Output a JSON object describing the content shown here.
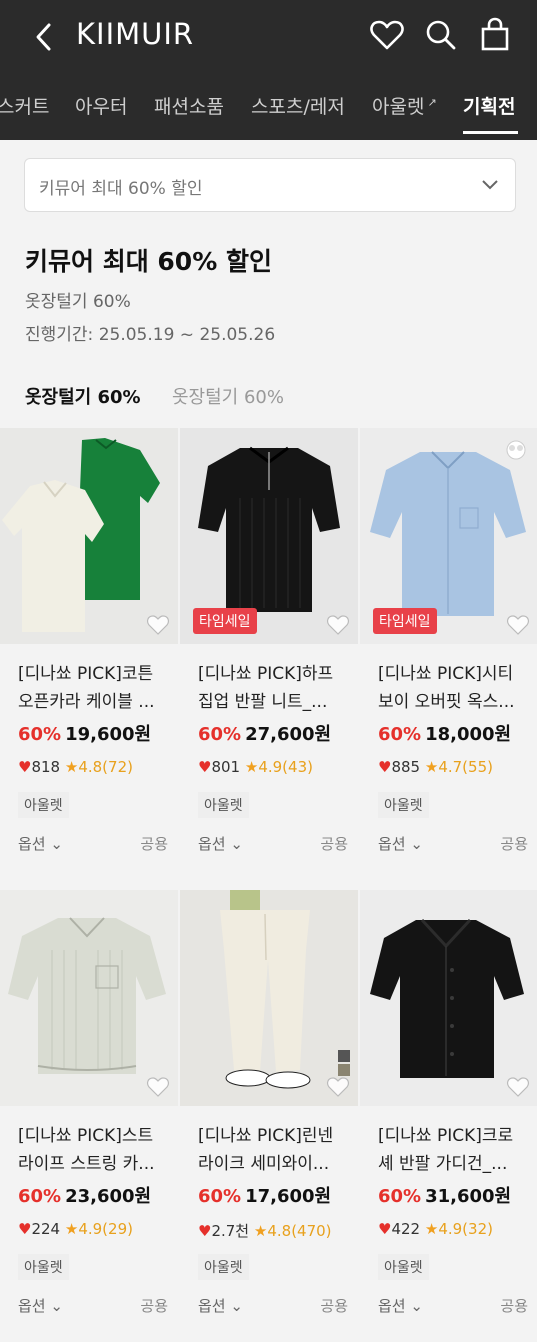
{
  "header": {
    "brand": "KIIMUIR"
  },
  "tabs": [
    {
      "label": "스커트",
      "active": false
    },
    {
      "label": "아우터",
      "active": false
    },
    {
      "label": "패션소품",
      "active": false
    },
    {
      "label": "스포츠/레저",
      "active": false
    },
    {
      "label": "아울렛",
      "active": false,
      "external": true
    },
    {
      "label": "기획전",
      "active": true
    }
  ],
  "promo_select": {
    "value": "키뮤어 최대 60% 할인"
  },
  "event": {
    "title": "키뮤어 최대 60% 할인",
    "subtitle": "옷장털기 60%",
    "period": "진행기간: 25.05.19 ~ 25.05.26"
  },
  "chips": [
    {
      "label": "옷장털기 60%",
      "selected": true
    },
    {
      "label": "옷장털기 60%",
      "selected": false
    }
  ],
  "products": [
    {
      "name_line1": "[디나쑈 PICK]코튼",
      "name_line2": "오픈카라 케이블 ...",
      "discount": "60%",
      "price": "19,600원",
      "likes": "818",
      "rating": "4.8(72)",
      "tag": "아울렛",
      "option": "옵션",
      "gender": "공용",
      "sale_badge": ""
    },
    {
      "name_line1": "[디나쑈 PICK]하프",
      "name_line2": "집업 반팔 니트_...",
      "discount": "60%",
      "price": "27,600원",
      "likes": "801",
      "rating": "4.9(43)",
      "tag": "아울렛",
      "option": "옵션",
      "gender": "공용",
      "sale_badge": "타임세일"
    },
    {
      "name_line1": "[디나쑈 PICK]시티",
      "name_line2": "보이 오버핏 옥스...",
      "discount": "60%",
      "price": "18,000원",
      "likes": "885",
      "rating": "4.7(55)",
      "tag": "아울렛",
      "option": "옵션",
      "gender": "공용",
      "sale_badge": "타임세일"
    },
    {
      "name_line1": "[디나쑈 PICK]스트",
      "name_line2": "라이프 스트링 카...",
      "discount": "60%",
      "price": "23,600원",
      "likes": "224",
      "rating": "4.9(29)",
      "tag": "아울렛",
      "option": "옵션",
      "gender": "공용",
      "sale_badge": ""
    },
    {
      "name_line1": "[디나쑈 PICK]린넨",
      "name_line2": "라이크 세미와이...",
      "discount": "60%",
      "price": "17,600원",
      "likes": "2.7천",
      "rating": "4.8(470)",
      "tag": "아울렛",
      "option": "옵션",
      "gender": "공용",
      "sale_badge": ""
    },
    {
      "name_line1": "[디나쑈 PICK]크로",
      "name_line2": "셰 반팔 가디건_...",
      "discount": "60%",
      "price": "31,600원",
      "likes": "422",
      "rating": "4.9(32)",
      "tag": "아울렛",
      "option": "옵션",
      "gender": "공용",
      "sale_badge": ""
    }
  ],
  "colors": {
    "header_bg": "#2b2b2b",
    "discount": "#e5302b",
    "sale_badge": "#e84149",
    "rating": "#f0a020"
  }
}
